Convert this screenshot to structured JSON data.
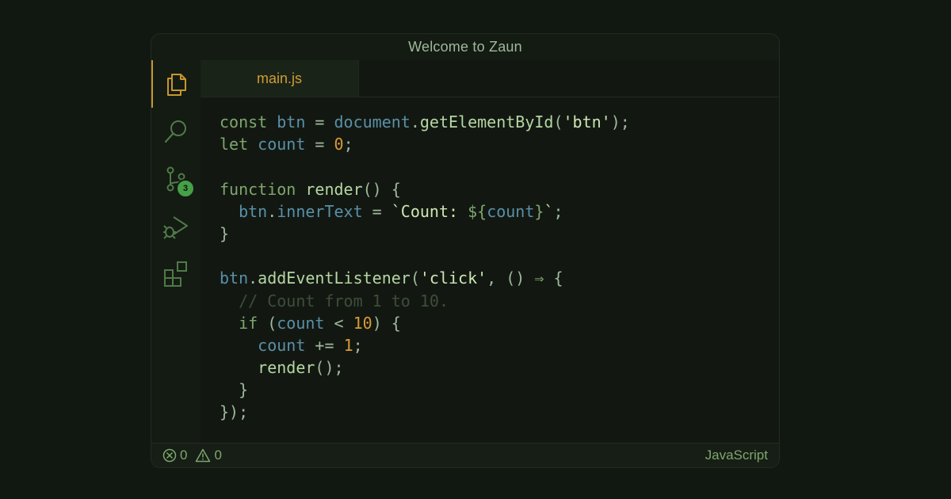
{
  "window": {
    "title": "Welcome to Zaun"
  },
  "activity_bar": {
    "items": [
      {
        "icon": "files-icon",
        "active": true
      },
      {
        "icon": "search-icon",
        "active": false
      },
      {
        "icon": "source-control-icon",
        "active": false,
        "badge": "3"
      },
      {
        "icon": "run-debug-icon",
        "active": false
      },
      {
        "icon": "extensions-icon",
        "active": false
      }
    ]
  },
  "tabs": [
    {
      "label": "main.js",
      "active": true
    }
  ],
  "code": {
    "lines": [
      [
        [
          "kw",
          "const "
        ],
        [
          "var",
          "btn"
        ],
        [
          "pun",
          " = "
        ],
        [
          "var",
          "document"
        ],
        [
          "pun",
          "."
        ],
        [
          "fn",
          "getElementById"
        ],
        [
          "pun",
          "("
        ],
        [
          "str",
          "'btn'"
        ],
        [
          "pun",
          ");"
        ]
      ],
      [
        [
          "kw",
          "let "
        ],
        [
          "var",
          "count"
        ],
        [
          "pun",
          " = "
        ],
        [
          "num",
          "0"
        ],
        [
          "pun",
          ";"
        ]
      ],
      [],
      [
        [
          "kw",
          "function "
        ],
        [
          "fn",
          "render"
        ],
        [
          "pun",
          "() {"
        ]
      ],
      [
        [
          "pun",
          "  "
        ],
        [
          "var",
          "btn"
        ],
        [
          "pun",
          "."
        ],
        [
          "var",
          "innerText"
        ],
        [
          "pun",
          " = "
        ],
        [
          "str",
          "`Count: "
        ],
        [
          "kw",
          "${"
        ],
        [
          "var",
          "count"
        ],
        [
          "kw",
          "}"
        ],
        [
          "str",
          "`"
        ],
        [
          "pun",
          ";"
        ]
      ],
      [
        [
          "pun",
          "}"
        ]
      ],
      [],
      [
        [
          "var",
          "btn"
        ],
        [
          "pun",
          "."
        ],
        [
          "fn",
          "addEventListener"
        ],
        [
          "pun",
          "("
        ],
        [
          "str",
          "'click'"
        ],
        [
          "pun",
          ", () "
        ],
        [
          "kw",
          "⇒"
        ],
        [
          "pun",
          " {"
        ]
      ],
      [
        [
          "cmt",
          "  // Count from 1 to 10."
        ]
      ],
      [
        [
          "pun",
          "  "
        ],
        [
          "kw",
          "if "
        ],
        [
          "pun",
          "("
        ],
        [
          "var",
          "count"
        ],
        [
          "pun",
          " < "
        ],
        [
          "num",
          "10"
        ],
        [
          "pun",
          ") {"
        ]
      ],
      [
        [
          "pun",
          "    "
        ],
        [
          "var",
          "count"
        ],
        [
          "pun",
          " += "
        ],
        [
          "num",
          "1"
        ],
        [
          "pun",
          ";"
        ]
      ],
      [
        [
          "pun",
          "    "
        ],
        [
          "fn",
          "render"
        ],
        [
          "pun",
          "();"
        ]
      ],
      [
        [
          "pun",
          "  }"
        ]
      ],
      [
        [
          "pun",
          "});"
        ]
      ]
    ]
  },
  "status_bar": {
    "errors": "0",
    "warnings": "0",
    "language": "JavaScript"
  },
  "colors": {
    "accent": "#c8962e",
    "background": "#111711",
    "badge": "#45a047"
  }
}
